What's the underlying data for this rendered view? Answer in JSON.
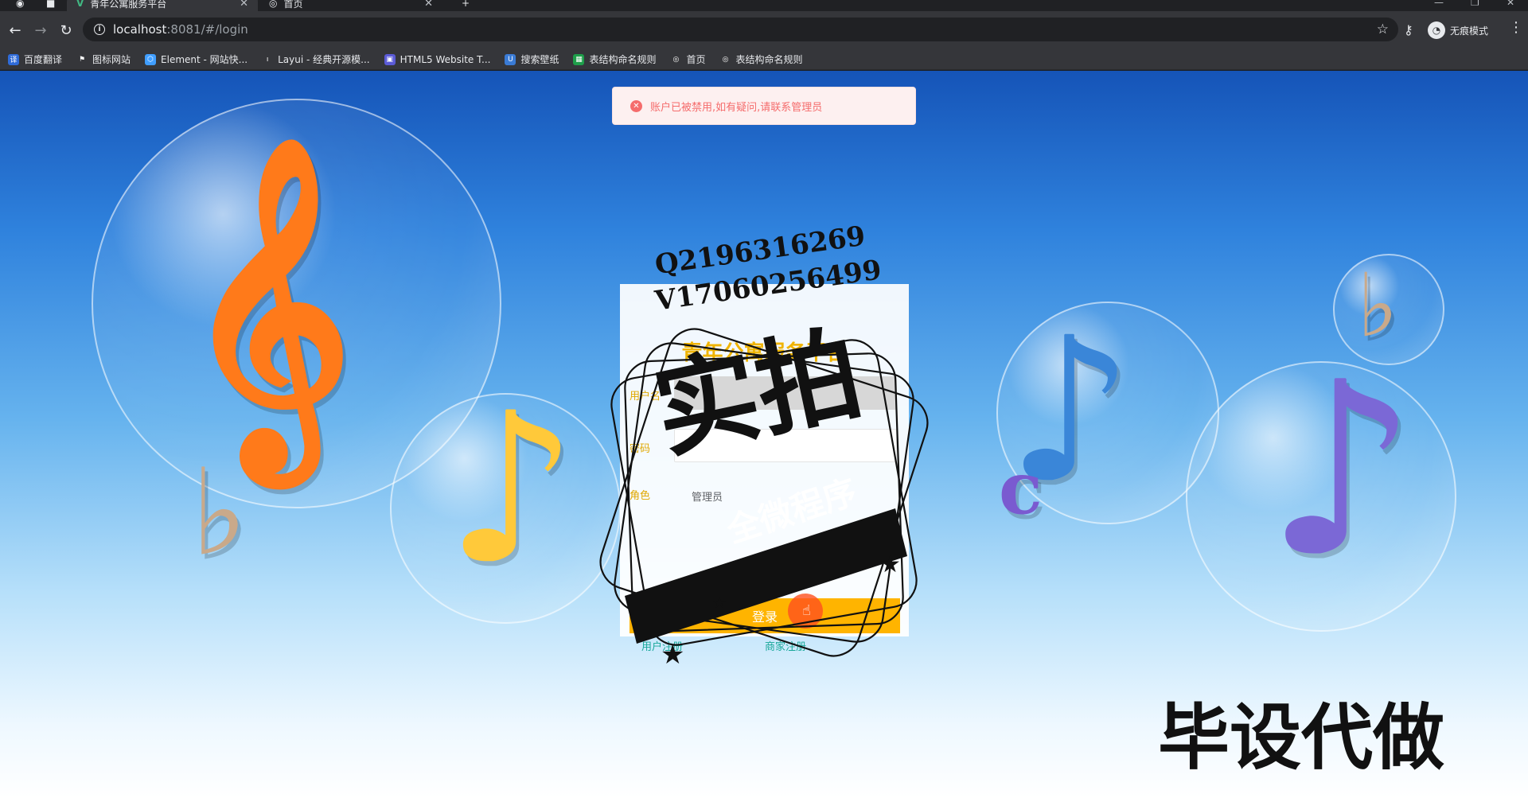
{
  "browser": {
    "tabs": [
      {
        "title": "青年公寓服务平台",
        "active": true
      },
      {
        "title": "首页",
        "active": false
      }
    ],
    "url_host": "localhost",
    "url_rest": ":8081/#/login",
    "profile_label": "无痕模式"
  },
  "bookmarks": [
    {
      "label": "百度翻译",
      "icon": "translate-icon",
      "color": "#2f6bd8"
    },
    {
      "label": "图标网站",
      "icon": "flag-icon",
      "color": "#35363a"
    },
    {
      "label": "Element - 网站快...",
      "icon": "element-icon",
      "color": "#409eff"
    },
    {
      "label": "Layui - 经典开源模...",
      "icon": "layui-icon",
      "color": "#35363a"
    },
    {
      "label": "HTML5 Website T...",
      "icon": "html5-icon",
      "color": "#5b5bd6"
    },
    {
      "label": "搜索壁纸",
      "icon": "wallpaper-icon",
      "color": "#3a7bd5"
    },
    {
      "label": "表结构命名规则",
      "icon": "sheet-icon",
      "color": "#1e9e4a"
    },
    {
      "label": "首页",
      "icon": "globe-icon",
      "color": "#35363a"
    },
    {
      "label": "表结构命名规则",
      "icon": "globe-icon",
      "color": "#35363a"
    }
  ],
  "alert": {
    "message": "账户已被禁用,如有疑问,请联系管理员"
  },
  "login": {
    "title": "青年公寓服务平台",
    "username_label": "用户名",
    "password_label": "密码",
    "role_label": "角色",
    "role_value": "管理员",
    "login_button": "登录",
    "register_user": "用户注册",
    "register_merchant": "商家注册"
  },
  "watermark": {
    "qq": "Q2196316269",
    "wechat": "V17060256499",
    "big": "实拍",
    "ribbon": "全微程序",
    "corner": "毕设代做"
  },
  "colors": {
    "accent": "#ffb400",
    "error": "#f56c6c",
    "link": "#1aa89a"
  }
}
